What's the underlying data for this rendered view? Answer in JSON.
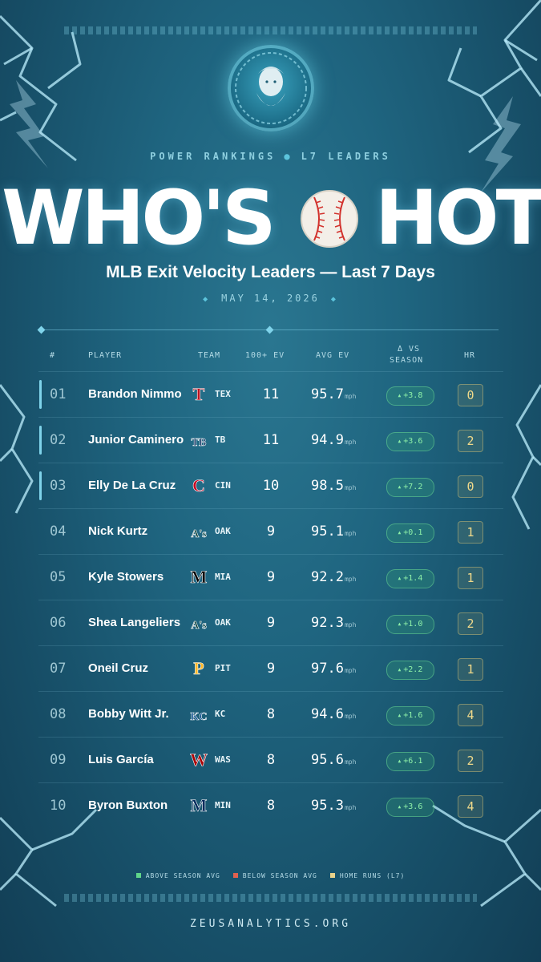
{
  "eyebrow": {
    "left": "POWER RANKINGS",
    "separator": "●",
    "right": "L7 LEADERS"
  },
  "hero": {
    "left": "WHO'S",
    "right": "HOT",
    "ball_icon": "baseball-icon"
  },
  "subtitle": "MLB Exit Velocity Leaders — Last 7 Days",
  "date": {
    "text": "MAY 14, 2026",
    "marker": "◆"
  },
  "table": {
    "headers": {
      "rank": "#",
      "player": "PLAYER",
      "team": "TEAM",
      "ev100": "100+ EV",
      "avg_ev": "AVG EV",
      "delta_line1": "Δ VS",
      "delta_line2": "SEASON",
      "hr": "HR"
    },
    "unit": "mph",
    "rows": [
      {
        "rank": "01",
        "player": "Brandon Nimmo",
        "team": "TEX",
        "ev100": "11",
        "avg": "95.7",
        "delta": "+3.8",
        "hr": "0",
        "logo_color": "#c0111f",
        "logo_letter": "T"
      },
      {
        "rank": "02",
        "player": "Junior Caminero",
        "team": "TB",
        "ev100": "11",
        "avg": "94.9",
        "delta": "+3.6",
        "hr": "2",
        "logo_color": "#092c5c",
        "logo_letter": "TB"
      },
      {
        "rank": "03",
        "player": "Elly De La Cruz",
        "team": "CIN",
        "ev100": "10",
        "avg": "98.5",
        "delta": "+7.2",
        "hr": "0",
        "logo_color": "#c6011f",
        "logo_letter": "C"
      },
      {
        "rank": "04",
        "player": "Nick Kurtz",
        "team": "OAK",
        "ev100": "9",
        "avg": "95.1",
        "delta": "+0.1",
        "hr": "1",
        "logo_color": "#003831",
        "logo_letter": "A's"
      },
      {
        "rank": "05",
        "player": "Kyle Stowers",
        "team": "MIA",
        "ev100": "9",
        "avg": "92.2",
        "delta": "+1.4",
        "hr": "1",
        "logo_color": "#000000",
        "logo_letter": "M"
      },
      {
        "rank": "06",
        "player": "Shea Langeliers",
        "team": "OAK",
        "ev100": "9",
        "avg": "92.3",
        "delta": "+1.0",
        "hr": "2",
        "logo_color": "#003831",
        "logo_letter": "A's"
      },
      {
        "rank": "07",
        "player": "Oneil Cruz",
        "team": "PIT",
        "ev100": "9",
        "avg": "97.6",
        "delta": "+2.2",
        "hr": "1",
        "logo_color": "#fdb827",
        "logo_letter": "P"
      },
      {
        "rank": "08",
        "player": "Bobby Witt Jr.",
        "team": "KC",
        "ev100": "8",
        "avg": "94.6",
        "delta": "+1.6",
        "hr": "4",
        "logo_color": "#004687",
        "logo_letter": "KC"
      },
      {
        "rank": "09",
        "player": "Luis García",
        "team": "WAS",
        "ev100": "8",
        "avg": "95.6",
        "delta": "+6.1",
        "hr": "2",
        "logo_color": "#ab0003",
        "logo_letter": "W"
      },
      {
        "rank": "10",
        "player": "Byron Buxton",
        "team": "MIN",
        "ev100": "8",
        "avg": "95.3",
        "delta": "+3.6",
        "hr": "4",
        "logo_color": "#002b5c",
        "logo_letter": "M"
      }
    ]
  },
  "legend": [
    {
      "label": "ABOVE SEASON AVG",
      "color": "#5fd68a"
    },
    {
      "label": "BELOW SEASON AVG",
      "color": "#e0614f"
    },
    {
      "label": "HOME RUNS (L7)",
      "color": "#e9d28a"
    }
  ],
  "footer": "ZEUSANALYTICS.ORG",
  "colors": {
    "accent": "#7fd3ea",
    "background": "#1f6580",
    "positive": "#8ef0a8",
    "hr": "#f0d98a"
  }
}
